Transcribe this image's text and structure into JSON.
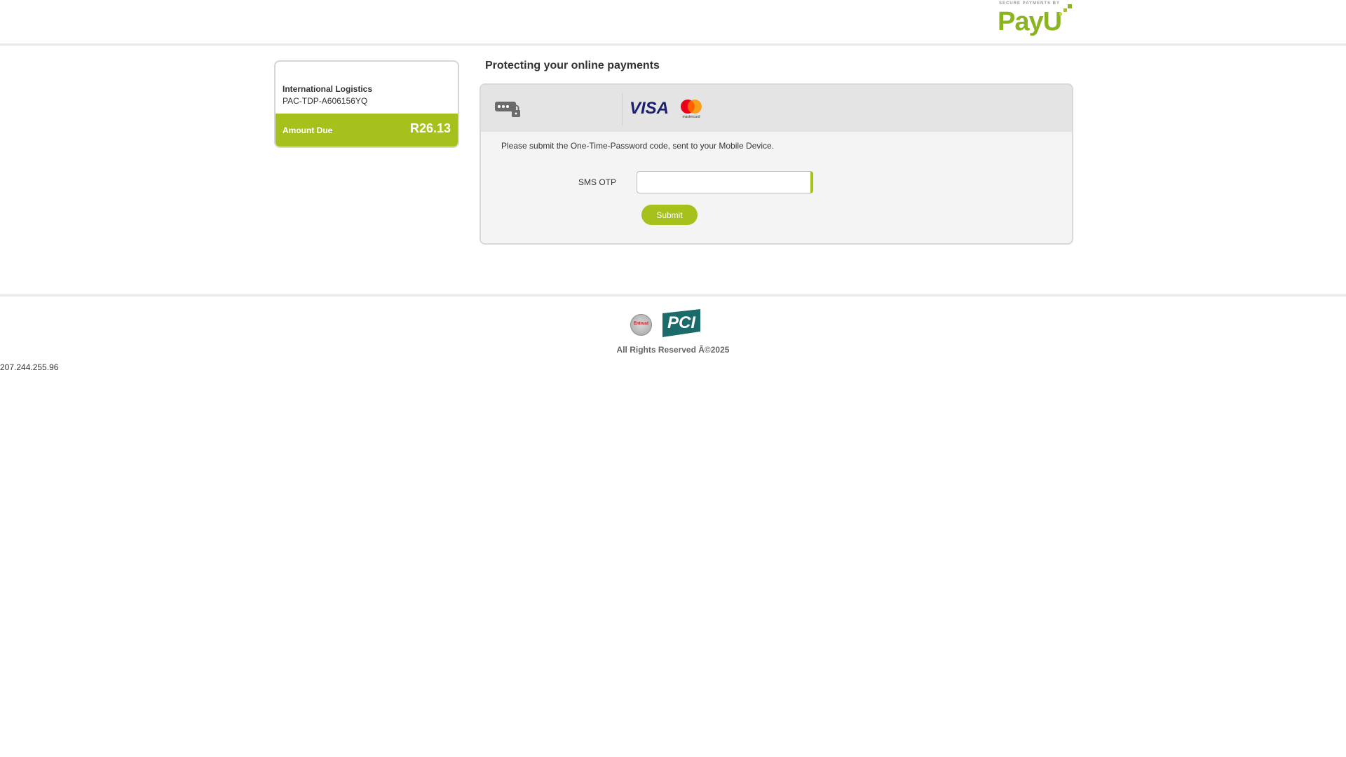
{
  "header": {
    "logo_tagline": "SECURE PAYMENTS BY",
    "logo_text": "PayU"
  },
  "merchant": {
    "name": "International Logistics",
    "reference": "PAC-TDP-A606156YQ",
    "amount_label": "Amount Due",
    "amount_value": "R26.13"
  },
  "main": {
    "title": "Protecting your online payments",
    "card_brands": [
      "VISA",
      "mastercard"
    ],
    "instruction": "Please submit the One-Time-Password code, sent to your Mobile Device.",
    "otp_label": "SMS OTP",
    "otp_value": "",
    "submit_label": "Submit"
  },
  "footer": {
    "seal_text": "Entrust",
    "pci_text": "PCI",
    "copyright": "All Rights Reserved Â©2025",
    "ip_address": "207.244.255.96"
  },
  "colors": {
    "accent": "#a6c11c",
    "payu_green": "#8bb520",
    "visa_blue": "#1a1f71",
    "pci_teal": "#1b6b6a"
  }
}
